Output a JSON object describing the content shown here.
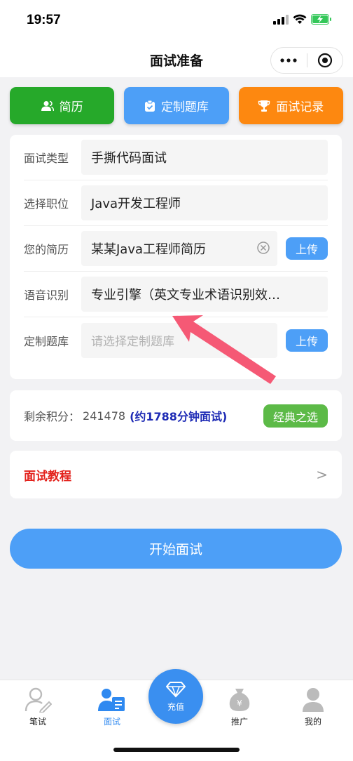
{
  "status": {
    "time": "19:57"
  },
  "nav": {
    "title": "面试准备",
    "more_icon": "more-dots-icon",
    "close_icon": "target-circle-icon"
  },
  "top_buttons": [
    {
      "label": "简历",
      "icon": "person-icon",
      "color": "#26a92a"
    },
    {
      "label": "定制题库",
      "icon": "clipboard-icon",
      "color": "#4d9ff7"
    },
    {
      "label": "面试记录",
      "icon": "trophy-icon",
      "color": "#fd8810"
    }
  ],
  "form": {
    "interview_type": {
      "label": "面试类型",
      "value": "手撕代码面试"
    },
    "position": {
      "label": "选择职位",
      "value": "Java开发工程师"
    },
    "resume": {
      "label": "您的简历",
      "value": "某某Java工程师简历",
      "upload": "上传"
    },
    "speech": {
      "label": "语音识别",
      "value": "专业引擎（英文专业术语识别效…"
    },
    "question_bank": {
      "label": "定制题库",
      "placeholder": "请选择定制题库",
      "upload": "上传"
    }
  },
  "credits": {
    "label": "剩余积分：",
    "value": "241478",
    "minutes": "(约1788分钟面试)",
    "classic_button": "经典之选"
  },
  "tutorial": {
    "label": "面试教程",
    "arrow": ">"
  },
  "start_button": "开始面试",
  "tabbar": {
    "written": "笔试",
    "interview": "面试",
    "recharge": "充值",
    "promote": "推广",
    "mine": "我的",
    "active_color": "#2f89f0"
  }
}
